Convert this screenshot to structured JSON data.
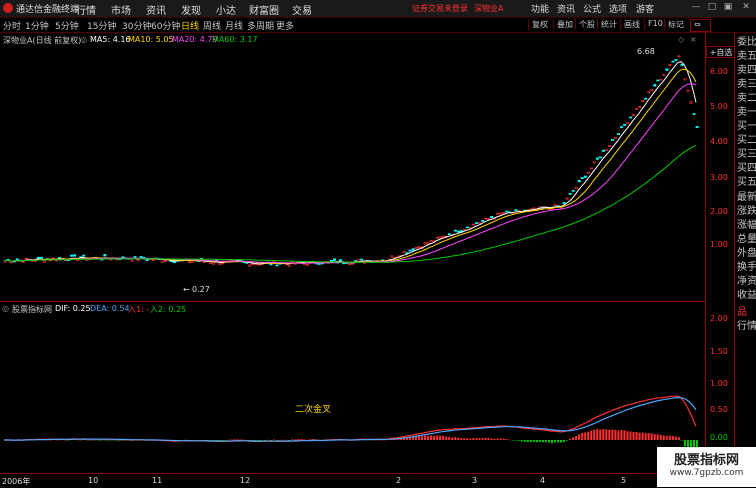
{
  "menubar": {
    "title": "通达信金融终端",
    "menus": [
      "行情",
      "市场",
      "资讯",
      "发现",
      "小达",
      "财富圈",
      "交易"
    ],
    "warning": "证券交易未登录",
    "stock_name": "深物业A",
    "right_menus": [
      "功能",
      "资讯",
      "公式",
      "选项",
      "游客"
    ]
  },
  "periodbar": {
    "periods": [
      "分时",
      "1分钟",
      "5分钟",
      "15分钟",
      "30分钟",
      "60分钟",
      "日线",
      "周线",
      "月线",
      "多周期",
      "更多"
    ],
    "active": "日线",
    "buttons": [
      "复权",
      "叠加",
      "个股",
      "统计",
      "画线",
      "F10",
      "标记"
    ]
  },
  "sidebar": {
    "items": [
      "委比",
      "卖五",
      "卖四",
      "卖三",
      "卖二",
      "卖一",
      "买一",
      "买二",
      "买三",
      "买四",
      "买五",
      "最新",
      "涨跌",
      "涨幅",
      "总量",
      "外盘",
      "换手",
      "净资",
      "收益",
      "品",
      "行情"
    ]
  },
  "main": {
    "stock_label": "深物业A(日线 前复权)",
    "ma5": "MA5: 4.16",
    "ma10": "MA10: 5.05",
    "ma20": "MA20: 4.79",
    "ma60": "MA60: 3.17",
    "self_select": "+自选",
    "high_label": "6.68",
    "low_label": "0.27",
    "colors": {
      "ma5": "#ffffff",
      "ma10": "#ffd700",
      "ma20": "#ff44ff",
      "ma60": "#00cc00",
      "up": "#ff3030",
      "down": "#00ffff"
    }
  },
  "sub": {
    "indicator_name": "股票指标网",
    "dif": "DIF: 0.25",
    "dea": "DEA: 0.54",
    "in1": "入1: -",
    "in2": "入2: 0.25",
    "annotation": "二次金叉"
  },
  "axis": {
    "main_ticks": [
      "6.00",
      "5.00",
      "4.00",
      "3.00",
      "2.00",
      "1.00"
    ],
    "sub_ticks": [
      "2.00",
      "1.50",
      "1.00",
      "0.50",
      "0.00"
    ]
  },
  "xaxis": {
    "labels": [
      "2006年",
      "10",
      "11",
      "12",
      "2",
      "3",
      "4",
      "5"
    ]
  },
  "watermark": {
    "title": "股票指标网",
    "url": "www.7gpzb.com"
  }
}
